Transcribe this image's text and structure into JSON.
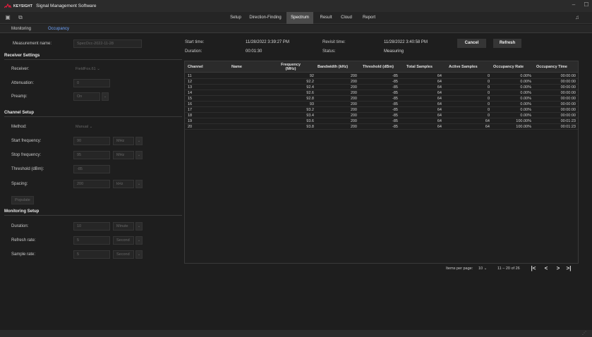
{
  "titlebar": {
    "brand": "KEYSIGHT",
    "app_title": "Signal Management Software",
    "brand_color": "#e31c3d"
  },
  "menubar": {
    "tabs": [
      "Setup",
      "Direction-Finding",
      "Spectrum",
      "Result",
      "Cloud",
      "Report"
    ],
    "active_tab": "Spectrum"
  },
  "subtabs": {
    "items": [
      "Monitoring",
      "Occupancy"
    ],
    "active": "Occupancy",
    "accent_color": "#6ea4ff"
  },
  "form": {
    "measurement_name": {
      "label": "Measurement name:",
      "placeholder": "SpecOcc-2022-11-28"
    },
    "receiver_settings": {
      "title": "Receiver Settings",
      "receiver": {
        "label": "Receiver:",
        "value": "FieldFox.61",
        "icon": "chevron-down-icon"
      },
      "attenuation": {
        "label": "Attenuation:",
        "value": "0"
      },
      "preamp": {
        "label": "Preamp:",
        "value": "On",
        "icon": "chevron-down-icon"
      }
    },
    "channel_setup": {
      "title": "Channel Setup",
      "method": {
        "label": "Method:",
        "value": "Manual",
        "icon": "chevron-down-icon"
      },
      "start_frequency": {
        "label": "Start frequency:",
        "value": "90",
        "unit": "MHz"
      },
      "stop_frequency": {
        "label": "Stop frequency:",
        "value": "95",
        "unit": "MHz"
      },
      "threshold": {
        "label": "Threshold (dBm):",
        "value": "-85"
      },
      "spacing": {
        "label": "Spacing:",
        "value": "200",
        "unit": "kHz"
      },
      "populate_button": "Populate"
    },
    "monitoring_setup": {
      "title": "Monitoring Setup",
      "duration": {
        "label": "Duration:",
        "value": "10",
        "unit": "Minute"
      },
      "refresh_rate": {
        "label": "Refresh rate:",
        "value": "5",
        "unit": "Second"
      },
      "sample_rate": {
        "label": "Sample rate:",
        "value": "5",
        "unit": "Second"
      }
    }
  },
  "summary": {
    "start_time_label": "Start time:",
    "start_time": "11/28/2022 3:39:27 PM",
    "duration_label": "Duration:",
    "duration": "00:01:30",
    "revisit_time_label": "Revisit time:",
    "revisit_time": "11/28/2022 3:40:58 PM",
    "status_label": "Status:",
    "status": "Measuring",
    "cancel_button": "Cancel",
    "refresh_button": "Refresh"
  },
  "table": {
    "headers": [
      "Channel",
      "Name",
      "Frequency (MHz)",
      "Bandwidth (kHz)",
      "Threshold (dBm)",
      "Total Samples",
      "Active Samples",
      "Occupancy Rate",
      "Occupancy Time"
    ],
    "rows": [
      [
        "11",
        "",
        "92",
        "200",
        "-85",
        "64",
        "0",
        "0.00%",
        "00:00:00"
      ],
      [
        "12",
        "",
        "92.2",
        "200",
        "-85",
        "64",
        "0",
        "0.00%",
        "00:00:00"
      ],
      [
        "13",
        "",
        "92.4",
        "200",
        "-85",
        "64",
        "0",
        "0.00%",
        "00:00:00"
      ],
      [
        "14",
        "",
        "92.6",
        "200",
        "-85",
        "64",
        "0",
        "0.00%",
        "00:00:00"
      ],
      [
        "15",
        "",
        "92.8",
        "200",
        "-85",
        "64",
        "0",
        "0.00%",
        "00:00:00"
      ],
      [
        "16",
        "",
        "93",
        "200",
        "-85",
        "64",
        "0",
        "0.00%",
        "00:00:00"
      ],
      [
        "17",
        "",
        "93.2",
        "200",
        "-85",
        "64",
        "0",
        "0.00%",
        "00:00:00"
      ],
      [
        "18",
        "",
        "93.4",
        "200",
        "-85",
        "64",
        "0",
        "0.00%",
        "00:00:00"
      ],
      [
        "19",
        "",
        "93.6",
        "200",
        "-85",
        "64",
        "64",
        "100.00%",
        "00:01:23"
      ],
      [
        "20",
        "",
        "93.8",
        "200",
        "-85",
        "64",
        "64",
        "100.00%",
        "00:01:23"
      ]
    ]
  },
  "pager": {
    "items_per_page_label": "Items per page:",
    "items_per_page": "10",
    "range": "11 – 20 of 26"
  }
}
